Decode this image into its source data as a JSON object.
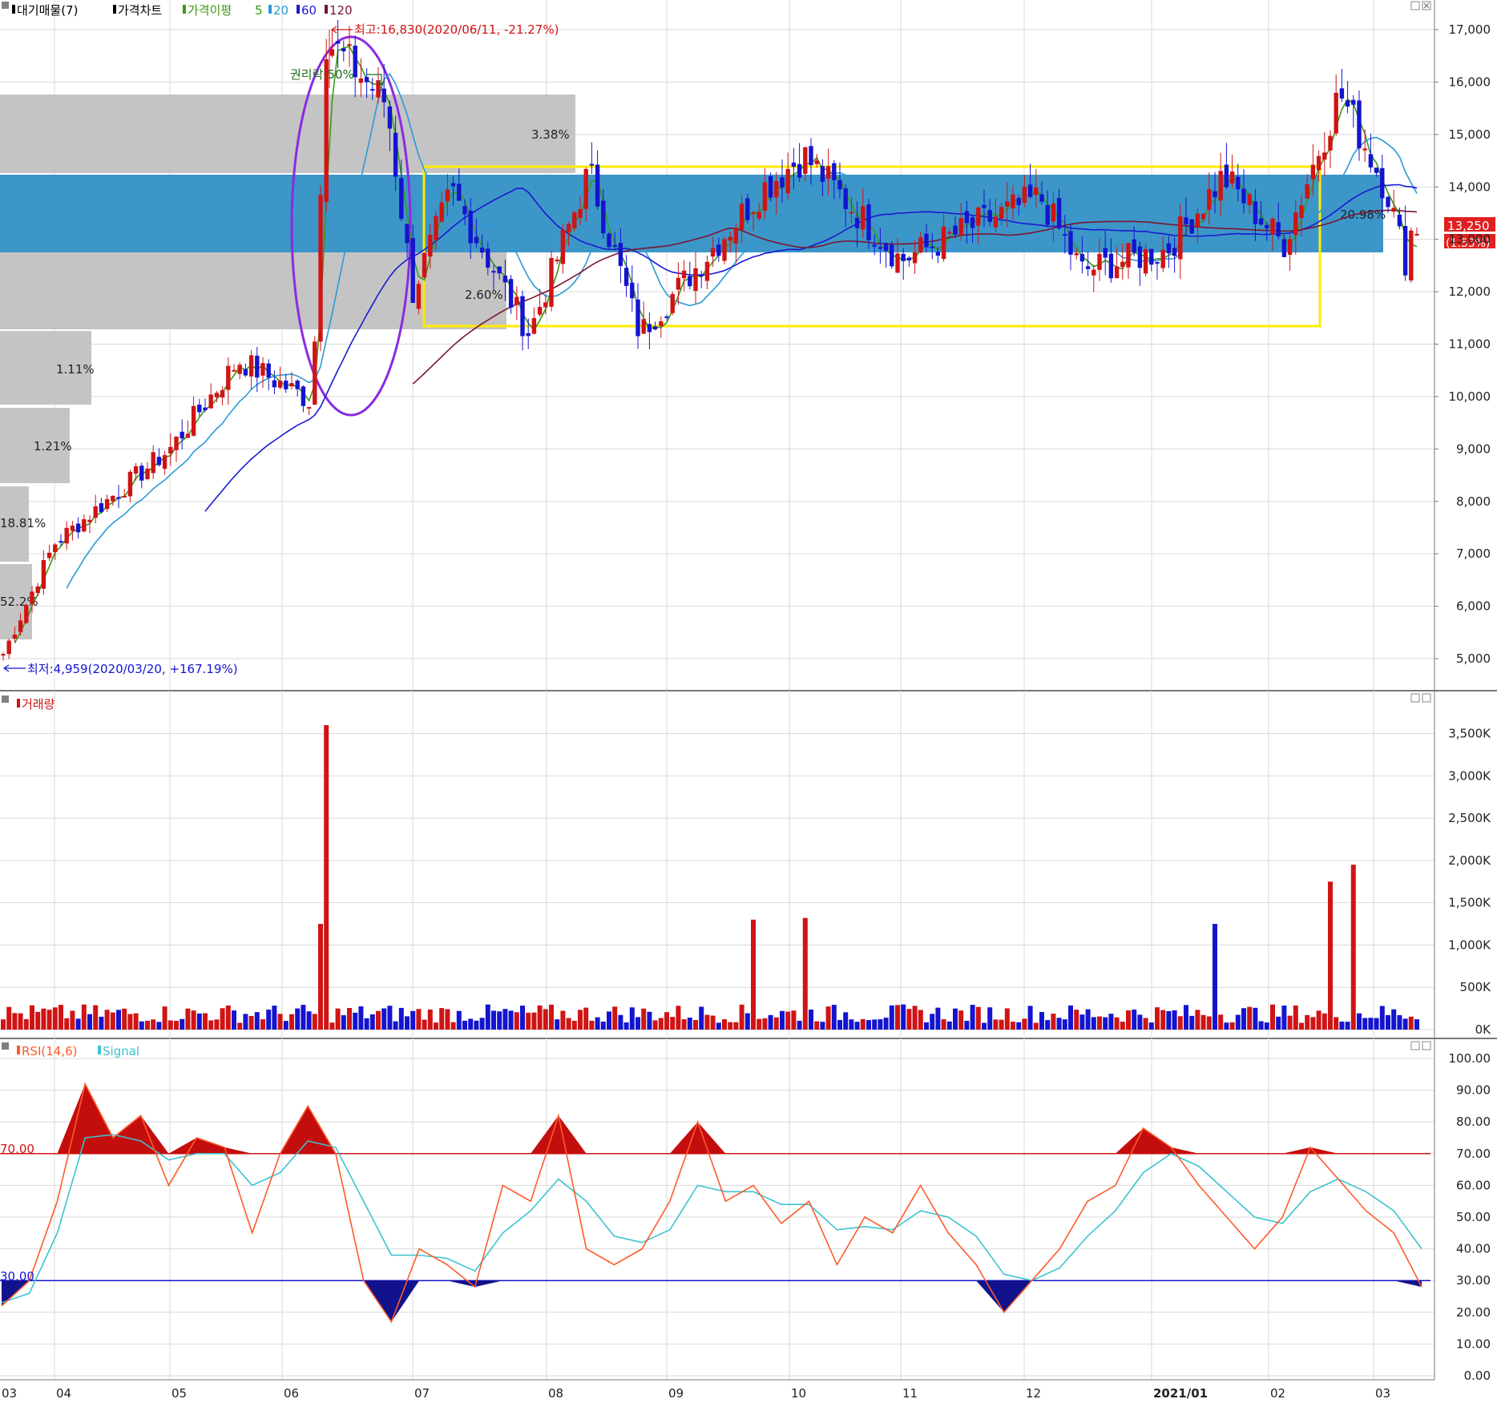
{
  "colors": {
    "up": "#d01414",
    "down": "#1414d0",
    "ma5": "#3a9a14",
    "ma20": "#2b9ad8",
    "ma60": "#1a1ad0",
    "ma120": "#7a1530",
    "zone_blue": "#3d96c8",
    "zone_gray": "#c4c4c4",
    "yellow_box": "#ffeb00",
    "ellipse": "#8a2be2",
    "rsi": "#ff5a2a",
    "signal": "#3cc3d0"
  },
  "legend": {
    "item1": "대기매물(7)",
    "item2": "가격차트",
    "item3": "가격이평",
    "item3_5": "5",
    "item3_20": "20",
    "item3_60": "60",
    "item3_120": "120"
  },
  "annotations": {
    "high": "최고:16,830(2020/06/11, -21.27%)",
    "low": "최저:4,959(2020/03/20, +167.19%)",
    "rights": "권리락:50%",
    "price_tag": "13,250",
    "pct_tag": "(1.53%)",
    "vp_labels": [
      "20.98%",
      "3.38%",
      "2.60%",
      "1.11%",
      "1.21%",
      "18.81%",
      "52.2%"
    ]
  },
  "volume_legend": "거래량",
  "rsi_legend": {
    "rsi": "RSI(14,6)",
    "signal": "Signal"
  },
  "rsi_levels": {
    "high": "70.00",
    "low": "30.00"
  },
  "x_ticks": [
    "03",
    "04",
    "05",
    "06",
    "07",
    "08",
    "09",
    "10",
    "11",
    "12",
    "2021/01",
    "02",
    "03"
  ],
  "chart_data": [
    {
      "type": "candlestick",
      "title": "가격차트",
      "ylim": [
        4500,
        17500
      ],
      "y_ticks": [
        "17,000",
        "16,000",
        "15,000",
        "14,000",
        "13,000",
        "12,000",
        "11,000",
        "10,000",
        "9,000",
        "8,000",
        "7,000",
        "6,000",
        "5,000"
      ],
      "key_points": [
        {
          "date": "2020/03/20",
          "value": 4959
        },
        {
          "date": "2020/04/01",
          "value": 7200
        },
        {
          "date": "2020/05/01",
          "value": 9000
        },
        {
          "date": "2020/05/20",
          "value": 10700
        },
        {
          "date": "2020/06/08",
          "value": 9900
        },
        {
          "date": "2020/06/11",
          "value": 16830
        },
        {
          "date": "2020/06/25",
          "value": 15600
        },
        {
          "date": "2020/07/01",
          "value": 12000
        },
        {
          "date": "2020/07/10",
          "value": 13900
        },
        {
          "date": "2020/07/28",
          "value": 11200
        },
        {
          "date": "2020/08/12",
          "value": 14300
        },
        {
          "date": "2020/08/25",
          "value": 11200
        },
        {
          "date": "2020/09/25",
          "value": 14000
        },
        {
          "date": "2020/10/05",
          "value": 14600
        },
        {
          "date": "2020/11/01",
          "value": 12600
        },
        {
          "date": "2020/11/20",
          "value": 13300
        },
        {
          "date": "2020/12/05",
          "value": 13800
        },
        {
          "date": "2020/12/15",
          "value": 12400
        },
        {
          "date": "2021/01/05",
          "value": 12800
        },
        {
          "date": "2021/01/20",
          "value": 14200
        },
        {
          "date": "2021/02/05",
          "value": 12900
        },
        {
          "date": "2021/02/20",
          "value": 15800
        },
        {
          "date": "2021/03/05",
          "value": 13900
        },
        {
          "date": "2021/03/10",
          "value": 12600
        },
        {
          "date": "2021/03/12",
          "value": 13250
        }
      ],
      "series": [
        {
          "name": "5"
        },
        {
          "name": "20"
        },
        {
          "name": "60"
        },
        {
          "name": "120"
        }
      ],
      "current_price": 13250,
      "current_change_pct": 1.53,
      "volume_profile": [
        {
          "low": 13200,
          "high": 14200,
          "pct": 52.2
        },
        {
          "low": 14200,
          "high": 15750,
          "pct": 20.98
        },
        {
          "low": 11300,
          "high": 12700,
          "pct": 18.81
        },
        {
          "low": 9800,
          "high": 11300,
          "pct": 3.38
        },
        {
          "low": 8350,
          "high": 9800,
          "pct": 2.6
        },
        {
          "low": 6900,
          "high": 8350,
          "pct": 1.11
        },
        {
          "low": 5400,
          "high": 6900,
          "pct": 1.21
        }
      ]
    },
    {
      "type": "bar",
      "title": "거래량",
      "ylim": [
        0,
        3600000
      ],
      "y_ticks": [
        "3,500K",
        "3,000K",
        "2,500K",
        "2,000K",
        "1,500K",
        "1,000K",
        "500K",
        "0K"
      ],
      "peaks": [
        {
          "date": "2020/06/11",
          "value": 3600000
        },
        {
          "date": "2020/06/10",
          "value": 1250000
        },
        {
          "date": "2020/09/22",
          "value": 1300000
        },
        {
          "date": "2020/10/05",
          "value": 1320000
        },
        {
          "date": "2021/01/18",
          "value": 1250000
        },
        {
          "date": "2021/02/18",
          "value": 1750000
        },
        {
          "date": "2021/02/23",
          "value": 1950000
        }
      ]
    },
    {
      "type": "line",
      "title": "RSI(14,6)",
      "ylim": [
        0,
        100
      ],
      "y_ticks": [
        "100.00",
        "90.00",
        "80.00",
        "70.00",
        "60.00",
        "50.00",
        "40.00",
        "30.00",
        "20.00",
        "10.00",
        "0.00"
      ],
      "series": [
        {
          "name": "RSI(14,6)",
          "values": [
            22,
            30,
            55,
            92,
            75,
            82,
            60,
            75,
            72,
            45,
            70,
            85,
            70,
            30,
            17,
            40,
            35,
            28,
            60,
            55,
            82,
            40,
            35,
            40,
            55,
            80,
            55,
            60,
            48,
            55,
            35,
            50,
            45,
            60,
            45,
            35,
            20,
            30,
            40,
            55,
            60,
            78,
            72,
            60,
            50,
            40,
            50,
            72,
            62,
            52,
            45,
            28
          ]
        },
        {
          "name": "Signal",
          "values": [
            23,
            26,
            45,
            75,
            76,
            74,
            68,
            70,
            70,
            60,
            64,
            74,
            72,
            55,
            38,
            38,
            37,
            33,
            45,
            52,
            62,
            55,
            44,
            42,
            46,
            60,
            58,
            58,
            54,
            54,
            46,
            47,
            46,
            52,
            50,
            44,
            32,
            30,
            34,
            44,
            52,
            64,
            70,
            66,
            58,
            50,
            48,
            58,
            62,
            58,
            52,
            40
          ]
        }
      ]
    }
  ]
}
